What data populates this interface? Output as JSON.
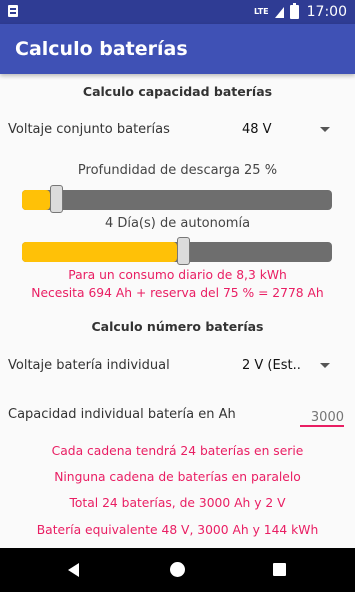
{
  "status_bar": {
    "network": "LTE",
    "time": "17:00"
  },
  "app_bar": {
    "title": "Calculo baterías"
  },
  "capacity_section": {
    "title": "Calculo capacidad baterías",
    "voltage_label": "Voltaje conjunto baterías",
    "voltage_value": "48 V",
    "discharge_label": "Profundidad de descarga 25 %",
    "discharge_percent": 25,
    "autonomy_label": "4 Día(s) de autonomía",
    "autonomy_fill_fraction": 0.5,
    "consumption_text": "Para un consumo diario de 8,3 kWh",
    "need_text": "Necesita 694 Ah + reserva del 75 % = 2778 Ah"
  },
  "number_section": {
    "title": "Calculo número baterías",
    "battery_voltage_label": "Voltaje batería individual",
    "battery_voltage_value": "2 V (Est..",
    "capacity_label": "Capacidad individual batería en Ah",
    "capacity_placeholder": "3000",
    "results": [
      "Cada cadena tendrá 24 baterías en serie",
      "Ninguna cadena de baterías en paralelo",
      "Total 24 baterías, de 3000 Ah y 2 V",
      "Batería equivalente 48 V, 3000 Ah y 144 kWh"
    ]
  },
  "colors": {
    "primary": "#3f51b5",
    "primary_dark": "#2f3c94",
    "accent_pink": "#e91e63",
    "slider_fill": "#ffc107"
  }
}
